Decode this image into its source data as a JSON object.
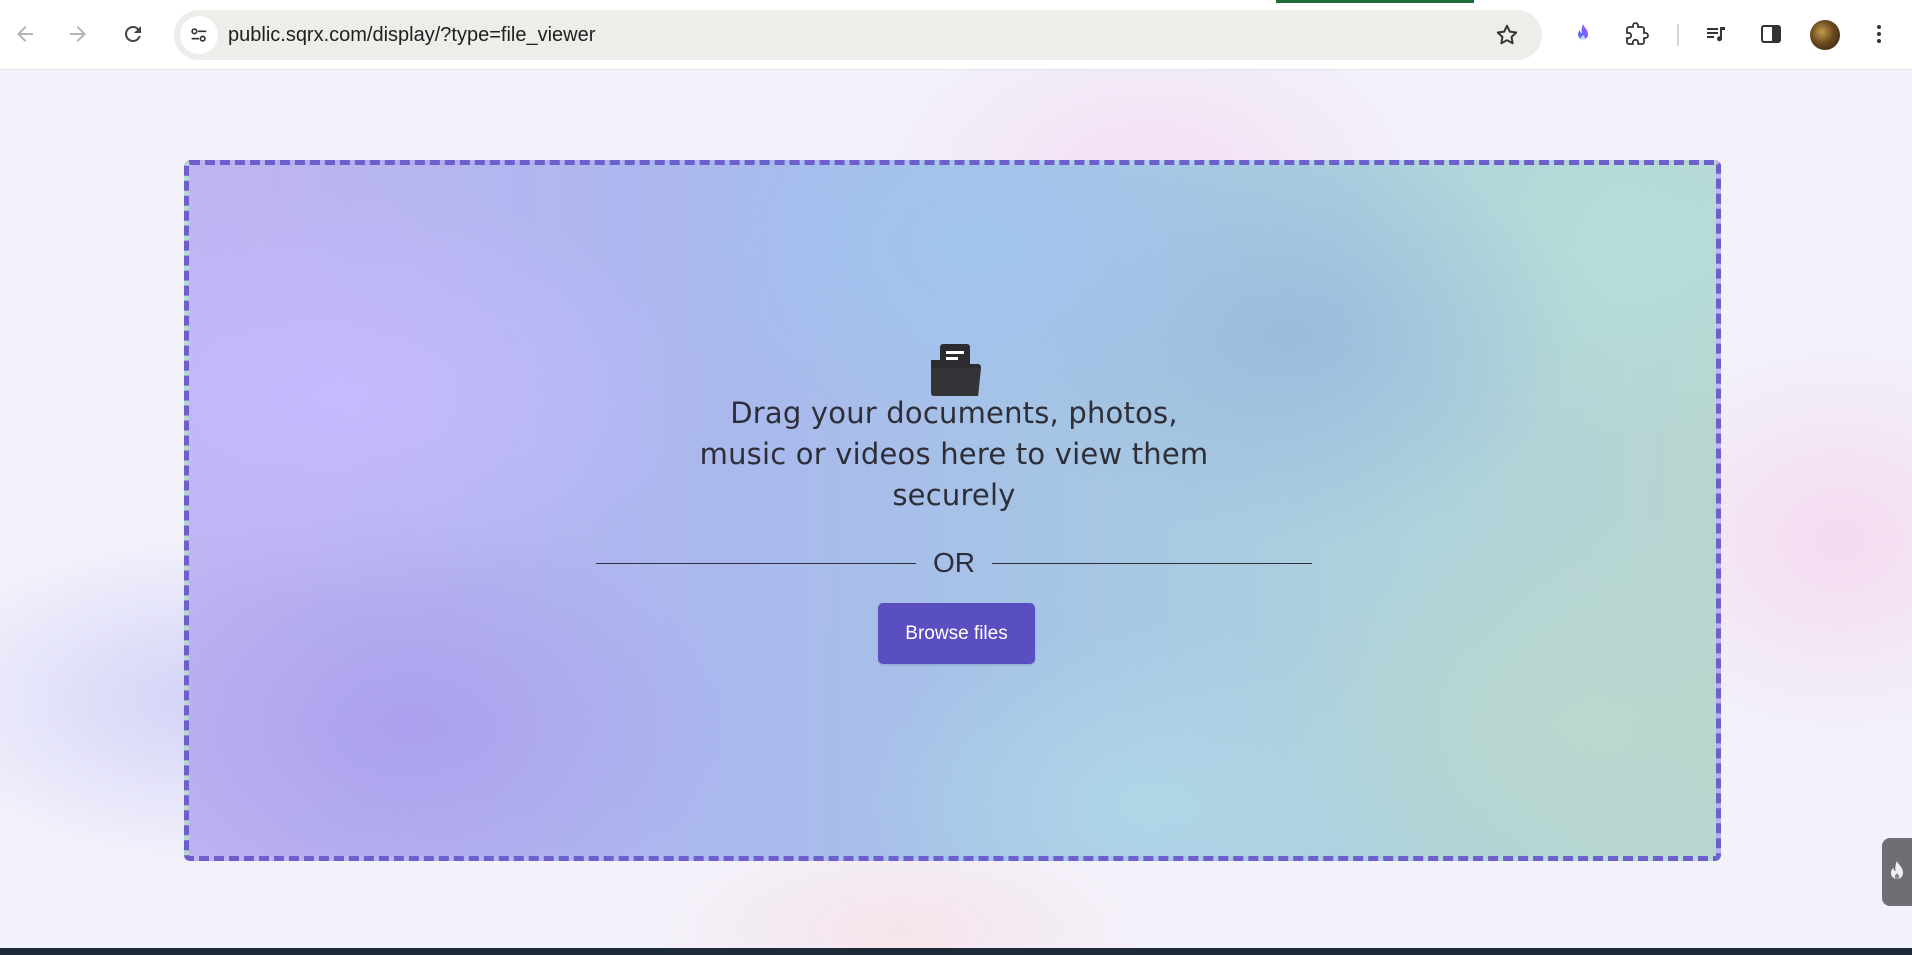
{
  "browser": {
    "url": "public.sqrx.com/display/?type=file_viewer",
    "icons": {
      "back": "arrow-left-icon",
      "forward": "arrow-right-icon",
      "reload": "reload-icon",
      "site_info": "tune-icon",
      "bookmark": "star-icon",
      "extension_flame": "flame-icon",
      "extensions": "puzzle-icon",
      "media": "media-playlist-icon",
      "side_panel": "side-panel-icon",
      "menu": "kebab-menu-icon"
    },
    "colors": {
      "omnibox_bg": "#eceee9",
      "flame_gradient": [
        "#3d7bff",
        "#b04cff"
      ]
    }
  },
  "dropzone": {
    "icon": "folder-document-icon",
    "headline": "Drag your documents, photos, music or videos here to view them securely",
    "divider_text": "OR",
    "browse_button_label": "Browse files",
    "colors": {
      "border": "#6d5fcc",
      "button_bg": "#5a4fc0",
      "text": "#2e2e38"
    }
  },
  "side_tab": {
    "icon": "flame-icon"
  }
}
